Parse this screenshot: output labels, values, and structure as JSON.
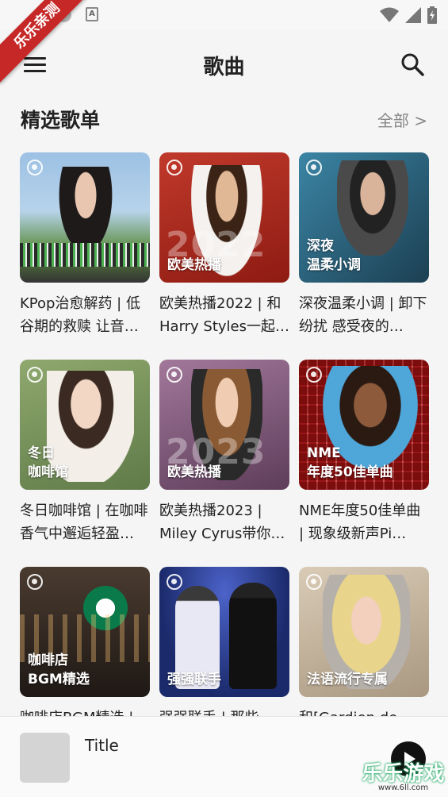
{
  "status_bar": {
    "icons": [
      "notification-dot-icon",
      "text-a-icon",
      "wifi-icon",
      "signal-icon",
      "battery-icon"
    ]
  },
  "badge": {
    "text": "乐乐亲测",
    "color": "#c62828"
  },
  "app_bar": {
    "title": "歌曲",
    "menu_icon": "hamburger-menu-icon",
    "search_icon": "search-icon"
  },
  "section": {
    "title": "精选歌单",
    "see_all": "全部 >"
  },
  "playlists": [
    {
      "title": "KPop治愈解药 | 低谷期的救赎 让音…",
      "overlay": "",
      "year": "",
      "bg": "#8fb3d9"
    },
    {
      "title": "欧美热播2022 | 和Harry Styles一起…",
      "overlay": "欧美热播",
      "year": "2022",
      "bg": "#c0392b"
    },
    {
      "title": "深夜温柔小调 | 卸下纷扰 感受夜的…",
      "overlay": "深夜\n温柔小调",
      "year": "",
      "bg": "#2e6f8a"
    },
    {
      "title": "冬日咖啡馆 | 在咖啡香气中邂逅轻盈…",
      "overlay": "冬日\n咖啡馆",
      "year": "",
      "bg": "#7d9a62"
    },
    {
      "title": "欧美热播2023 | Miley Cyrus带你…",
      "overlay": "欧美热播",
      "year": "2023",
      "bg": "#8e5f86"
    },
    {
      "title": "NME年度50佳单曲 | 现象级新声Pi…",
      "overlay": "NME\n年度50佳单曲",
      "year": "",
      "bg": "#b23a3a"
    },
    {
      "title": "咖啡店BGM精选 |",
      "overlay": "咖啡店\nBGM精选",
      "year": "",
      "bg": "#3a2f28"
    },
    {
      "title": "强强联手 | 那些一",
      "overlay": "强强联手",
      "year": "",
      "bg": "#2b3f8c"
    },
    {
      "title": "和[Gardien de nuit]",
      "overlay": "法语流行专属",
      "year": "",
      "bg": "#c9b9a3"
    }
  ],
  "player": {
    "title": "Title",
    "play_icon": "play-icon"
  },
  "watermark": {
    "text": "乐乐游戏",
    "url": "www.6ll.com"
  }
}
